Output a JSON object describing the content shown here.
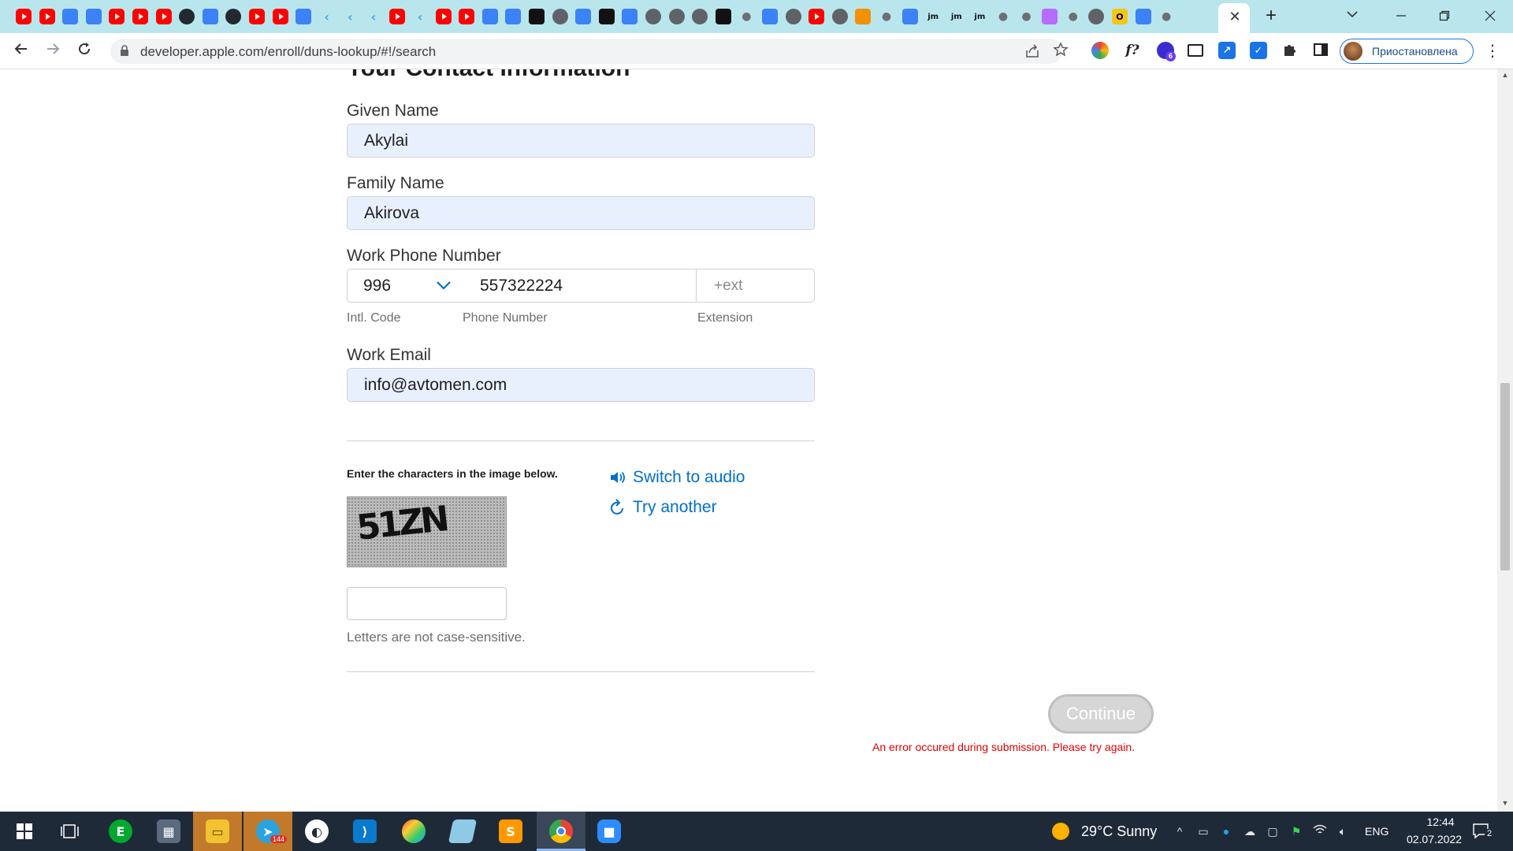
{
  "browser": {
    "url": "developer.apple.com/enroll/duns-lookup/#!/search",
    "profile_label": "Приостановлена",
    "close_tab_glyph": "✕",
    "new_tab_glyph": "+",
    "ext_badge": "6",
    "tab_favicons": [
      "youtube",
      "youtube",
      "generic",
      "generic",
      "youtube",
      "youtube",
      "youtube",
      "github",
      "generic",
      "github",
      "youtube",
      "youtube",
      "generic",
      "flutter",
      "flutter",
      "flutter",
      "youtube",
      "flutter",
      "youtube",
      "youtube",
      "generic",
      "generic",
      "dark",
      "chrome",
      "generic",
      "dark",
      "generic",
      "chrome",
      "chrome",
      "chrome",
      "dark",
      "apple",
      "generic",
      "chrome",
      "youtube",
      "chrome",
      "orange",
      "apple",
      "generic",
      "text",
      "text",
      "text",
      "apple",
      "apple",
      "purple",
      "apple",
      "chrome",
      "yellow",
      "generic",
      "apple"
    ]
  },
  "page": {
    "section_title": "Your Contact Information",
    "given_name": {
      "label": "Given Name",
      "value": "Akylai"
    },
    "family_name": {
      "label": "Family Name",
      "value": "Akirova"
    },
    "work_phone": {
      "label": "Work Phone Number",
      "intl_code": "996",
      "number": "557322224",
      "ext_placeholder": "+ext",
      "intl_code_label": "Intl. Code",
      "number_label": "Phone Number",
      "ext_label": "Extension"
    },
    "work_email": {
      "label": "Work Email",
      "value": "info@avtomen.com"
    },
    "captcha": {
      "instructions": "Enter the characters in the image below.",
      "image_text": "51ZN",
      "switch_audio": "Switch to audio",
      "try_another": "Try another",
      "hint": "Letters are not case-sensitive.",
      "value": ""
    },
    "continue_label": "Continue",
    "error_message": "An error occured during submission. Please try again."
  },
  "colors": {
    "tabstrip": "#b9e6ed",
    "link_blue": "#0070c9",
    "error_red": "#e30000",
    "autofill_bg": "#e8f0fe",
    "taskbar": "#1f2a38"
  },
  "taskbar": {
    "apps": [
      "windows-start",
      "task-view",
      "evernote",
      "calculator",
      "file-explorer",
      "telegram",
      "app-circle",
      "vscode",
      "paint",
      "notepad",
      "sublime-text",
      "chrome",
      "zoom"
    ],
    "telegram_badge": "144",
    "weather": "29°C  Sunny",
    "language": "ENG",
    "time": "12:44",
    "date": "02.07.2022",
    "notification_count": "2"
  }
}
